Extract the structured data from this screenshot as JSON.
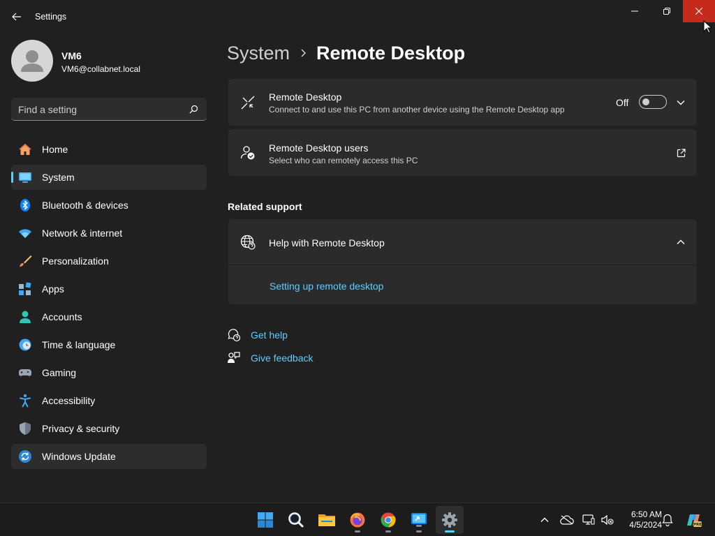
{
  "window": {
    "title": "Settings"
  },
  "profile": {
    "name": "VM6",
    "email": "VM6@collabnet.local"
  },
  "search": {
    "placeholder": "Find a setting",
    "value": ""
  },
  "sidebar": {
    "items": [
      {
        "label": "Home",
        "icon": "home-icon"
      },
      {
        "label": "System",
        "icon": "system-icon",
        "selected": true
      },
      {
        "label": "Bluetooth & devices",
        "icon": "bluetooth-icon"
      },
      {
        "label": "Network & internet",
        "icon": "wifi-icon"
      },
      {
        "label": "Personalization",
        "icon": "brush-icon"
      },
      {
        "label": "Apps",
        "icon": "apps-icon"
      },
      {
        "label": "Accounts",
        "icon": "accounts-icon"
      },
      {
        "label": "Time & language",
        "icon": "clock-globe-icon"
      },
      {
        "label": "Gaming",
        "icon": "gamepad-icon"
      },
      {
        "label": "Accessibility",
        "icon": "accessibility-icon"
      },
      {
        "label": "Privacy & security",
        "icon": "shield-icon"
      },
      {
        "label": "Windows Update",
        "icon": "update-icon",
        "hovered": true
      }
    ]
  },
  "breadcrumb": {
    "parent": "System",
    "current": "Remote Desktop"
  },
  "remote_desktop": {
    "title": "Remote Desktop",
    "description": "Connect to and use this PC from another device using the Remote Desktop app",
    "toggle_state": "Off",
    "enabled": false
  },
  "remote_users": {
    "title": "Remote Desktop users",
    "description": "Select who can remotely access this PC"
  },
  "related_support": {
    "heading": "Related support",
    "help_title": "Help with Remote Desktop",
    "expanded": true,
    "links": [
      "Setting up remote desktop"
    ]
  },
  "footer_links": {
    "get_help": "Get help",
    "give_feedback": "Give feedback"
  },
  "taskbar": {
    "apps": [
      "start-icon",
      "search-icon",
      "file-explorer-icon",
      "firefox-icon",
      "chrome-icon",
      "remote-desktop-app-icon",
      "settings-icon"
    ],
    "active_app": "settings-icon",
    "time": "6:50 AM",
    "date": "4/5/2024"
  },
  "colors": {
    "background": "#202020",
    "card": "#2b2b2b",
    "accent": "#60cdff",
    "close_button": "#c42b1c"
  }
}
